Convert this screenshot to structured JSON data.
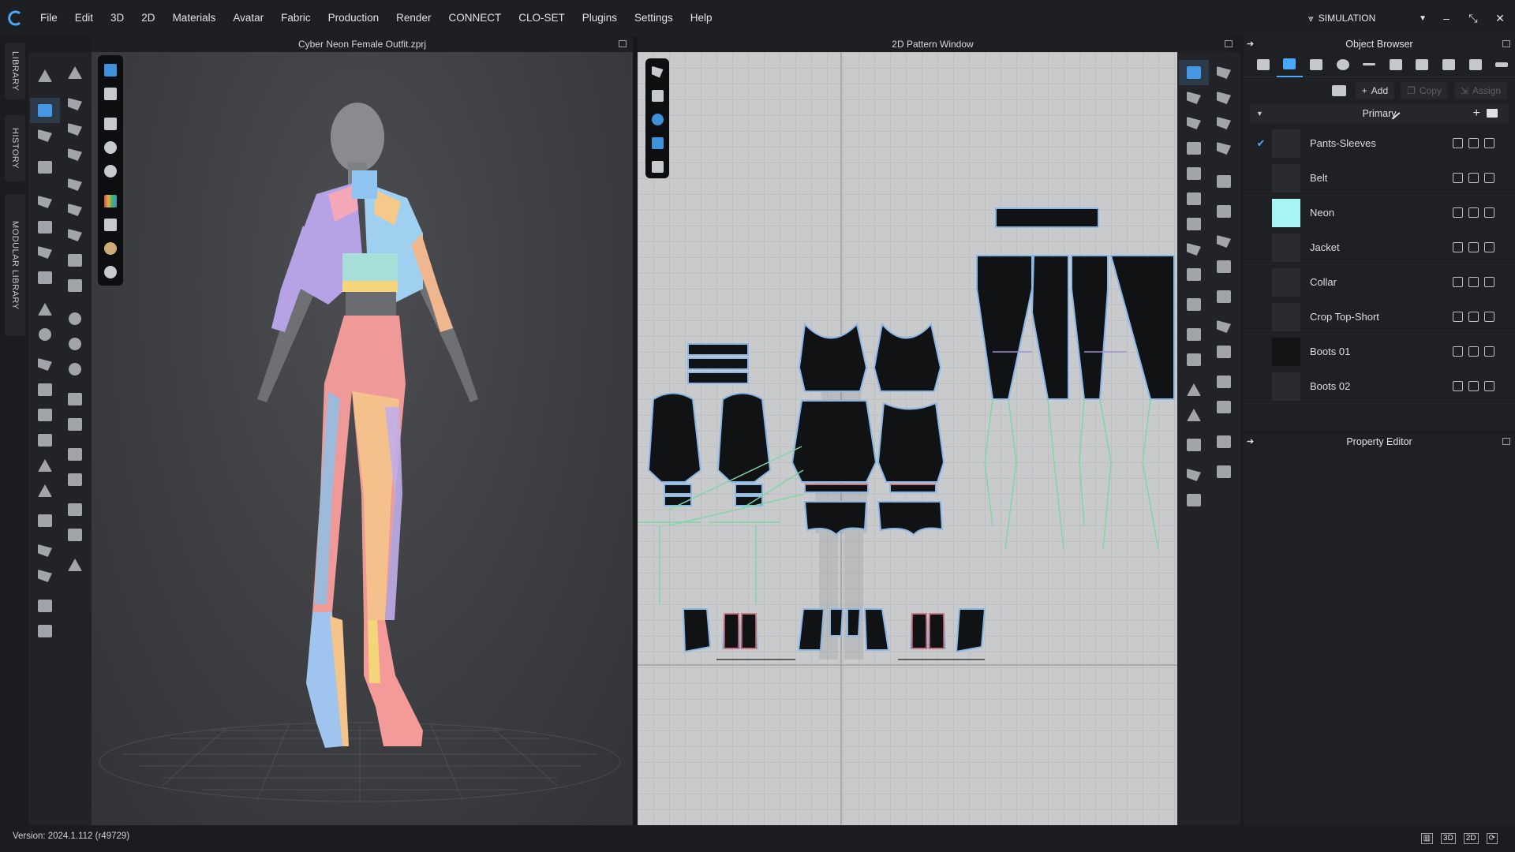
{
  "menu": {
    "items": [
      "File",
      "Edit",
      "3D",
      "2D",
      "Materials",
      "Avatar",
      "Fabric",
      "Production",
      "Render",
      "CONNECT",
      "CLO-SET",
      "Plugins",
      "Settings",
      "Help"
    ],
    "mode_label": "SIMULATION"
  },
  "sidebar_tabs": {
    "library": "LIBRARY",
    "history": "HISTORY",
    "modular_library": "MODULAR LIBRARY"
  },
  "viewport3d": {
    "title": "Cyber Neon Female Outfit.zprj"
  },
  "viewport2d": {
    "title": "2D Pattern Window"
  },
  "object_browser": {
    "title": "Object Browser",
    "actions": {
      "add": "Add",
      "copy": "Copy",
      "assign": "Assign"
    },
    "group": "Primary",
    "fabrics": [
      {
        "name": "Pants-Sleeves",
        "checked": true,
        "swatch": "#2a2b2f"
      },
      {
        "name": "Belt",
        "checked": false,
        "swatch": "#2a2b2f"
      },
      {
        "name": "Neon",
        "checked": false,
        "swatch": "#a8f3f4"
      },
      {
        "name": "Jacket",
        "checked": false,
        "swatch": "#2a2b2f"
      },
      {
        "name": "Collar",
        "checked": false,
        "swatch": "#2a2b2f"
      },
      {
        "name": "Crop Top-Short",
        "checked": false,
        "swatch": "#2a2b2f"
      },
      {
        "name": "Boots 01",
        "checked": false,
        "swatch": "#141416"
      },
      {
        "name": "Boots 02",
        "checked": false,
        "swatch": "#2a2b2f"
      }
    ]
  },
  "property_editor": {
    "title": "Property Editor"
  },
  "status": {
    "version": "Version: 2024.1.112 (r49729)"
  },
  "colors": {
    "accent": "#4aa8ff",
    "neon_swatch": "#a8f3f4",
    "pattern_stitch": "#7fd6a8",
    "pattern_outline": "#8ab8e8"
  }
}
